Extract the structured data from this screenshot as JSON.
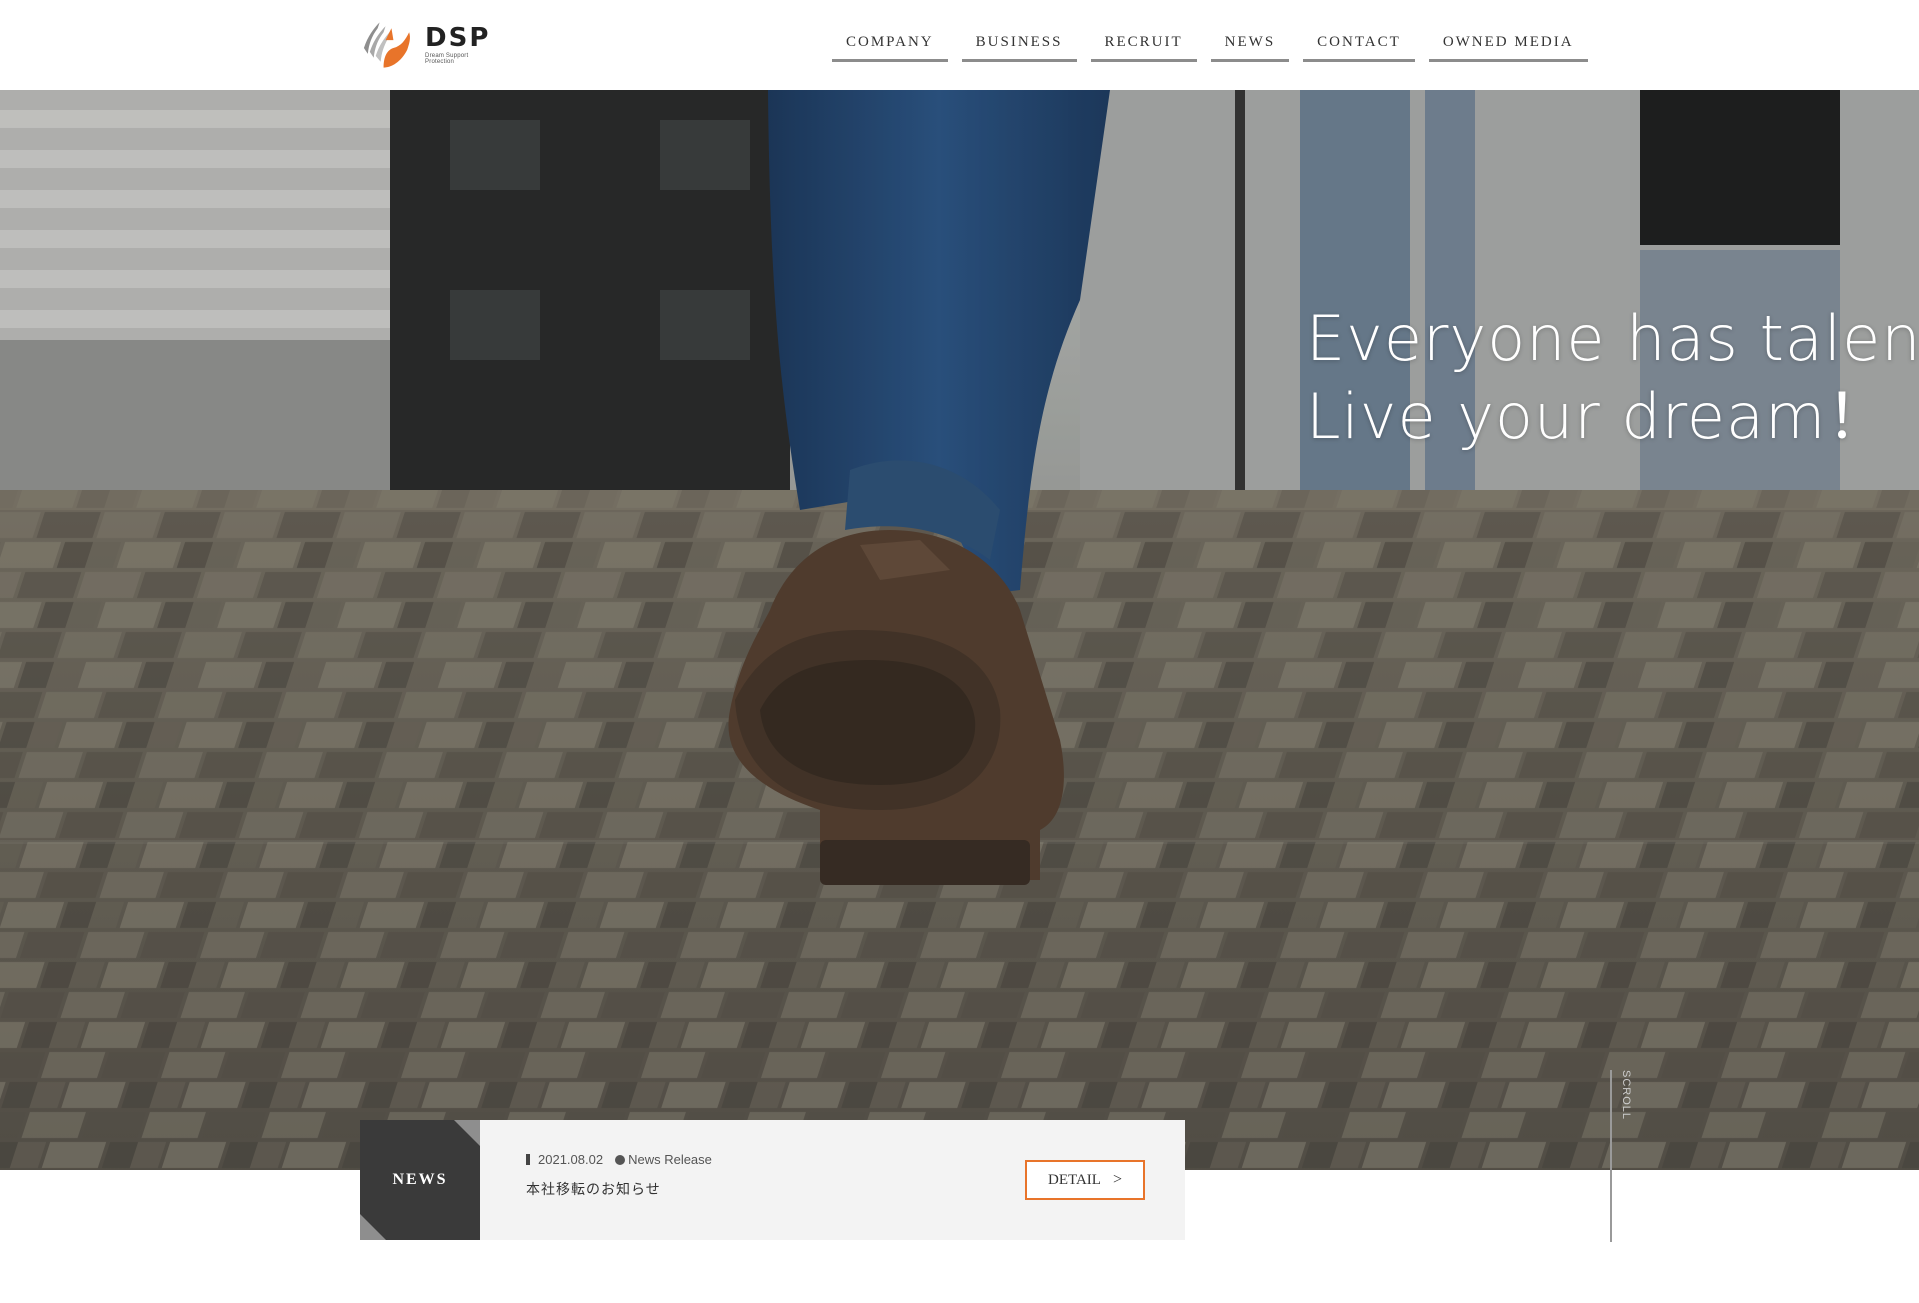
{
  "brand": {
    "name": "DSP",
    "tagline": "Dream Support Protection",
    "accent_color": "#e8742a"
  },
  "nav": {
    "items": [
      {
        "label": "COMPANY"
      },
      {
        "label": "BUSINESS"
      },
      {
        "label": "RECRUIT"
      },
      {
        "label": "NEWS"
      },
      {
        "label": "CONTACT"
      },
      {
        "label": "OWNED MEDIA"
      }
    ]
  },
  "hero": {
    "line1": "Everyone has talent.",
    "line2": "Live your dream！"
  },
  "news": {
    "label": "NEWS",
    "date": "2021.08.02",
    "category": "News Release",
    "title": "本社移転のお知らせ",
    "detail_label": "DETAIL",
    "detail_arrow": ">"
  },
  "scroll": {
    "label": "SCROLL"
  }
}
